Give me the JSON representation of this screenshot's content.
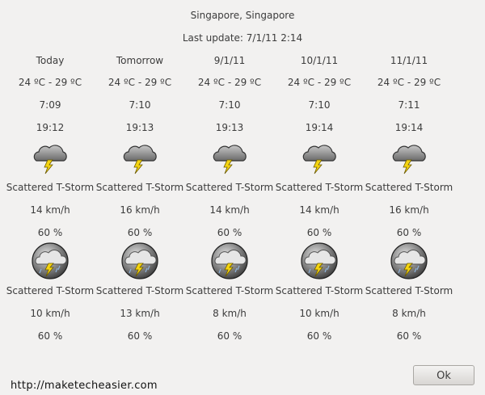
{
  "location": "Singapore, Singapore",
  "last_update": "Last update: 7/1/11 2:14",
  "days": [
    {
      "label": "Today",
      "temp": "24 ºC - 29 ºC",
      "sunrise": "7:09",
      "sunset": "19:12",
      "day": {
        "icon": "thunderstorm-icon",
        "condition": "Scattered T-Storm",
        "wind": "14 km/h",
        "humidity": "60 %"
      },
      "night": {
        "icon": "night-thunderstorm-icon",
        "condition": "Scattered T-Storm",
        "wind": "10 km/h",
        "humidity": "60 %"
      }
    },
    {
      "label": "Tomorrow",
      "temp": "24 ºC - 29 ºC",
      "sunrise": "7:10",
      "sunset": "19:13",
      "day": {
        "icon": "thunderstorm-icon",
        "condition": "Scattered T-Storm",
        "wind": "16 km/h",
        "humidity": "60 %"
      },
      "night": {
        "icon": "night-thunderstorm-icon",
        "condition": "Scattered T-Storm",
        "wind": "13 km/h",
        "humidity": "60 %"
      }
    },
    {
      "label": "9/1/11",
      "temp": "24 ºC - 29 ºC",
      "sunrise": "7:10",
      "sunset": "19:13",
      "day": {
        "icon": "thunderstorm-icon",
        "condition": "Scattered T-Storm",
        "wind": "14 km/h",
        "humidity": "60 %"
      },
      "night": {
        "icon": "night-thunderstorm-icon",
        "condition": "Scattered T-Storm",
        "wind": "8 km/h",
        "humidity": "60 %"
      }
    },
    {
      "label": "10/1/11",
      "temp": "24 ºC - 29 ºC",
      "sunrise": "7:10",
      "sunset": "19:14",
      "day": {
        "icon": "thunderstorm-icon",
        "condition": "Scattered T-Storm",
        "wind": "14 km/h",
        "humidity": "60 %"
      },
      "night": {
        "icon": "night-thunderstorm-icon",
        "condition": "Scattered T-Storm",
        "wind": "10 km/h",
        "humidity": "60 %"
      }
    },
    {
      "label": "11/1/11",
      "temp": "24 ºC - 29 ºC",
      "sunrise": "7:11",
      "sunset": "19:14",
      "day": {
        "icon": "thunderstorm-icon",
        "condition": "Scattered T-Storm",
        "wind": "16 km/h",
        "humidity": "60 %"
      },
      "night": {
        "icon": "night-thunderstorm-icon",
        "condition": "Scattered T-Storm",
        "wind": "8 km/h",
        "humidity": "60 %"
      }
    }
  ],
  "ok_label": "Ok",
  "watermark": "http://maketecheasier.com"
}
